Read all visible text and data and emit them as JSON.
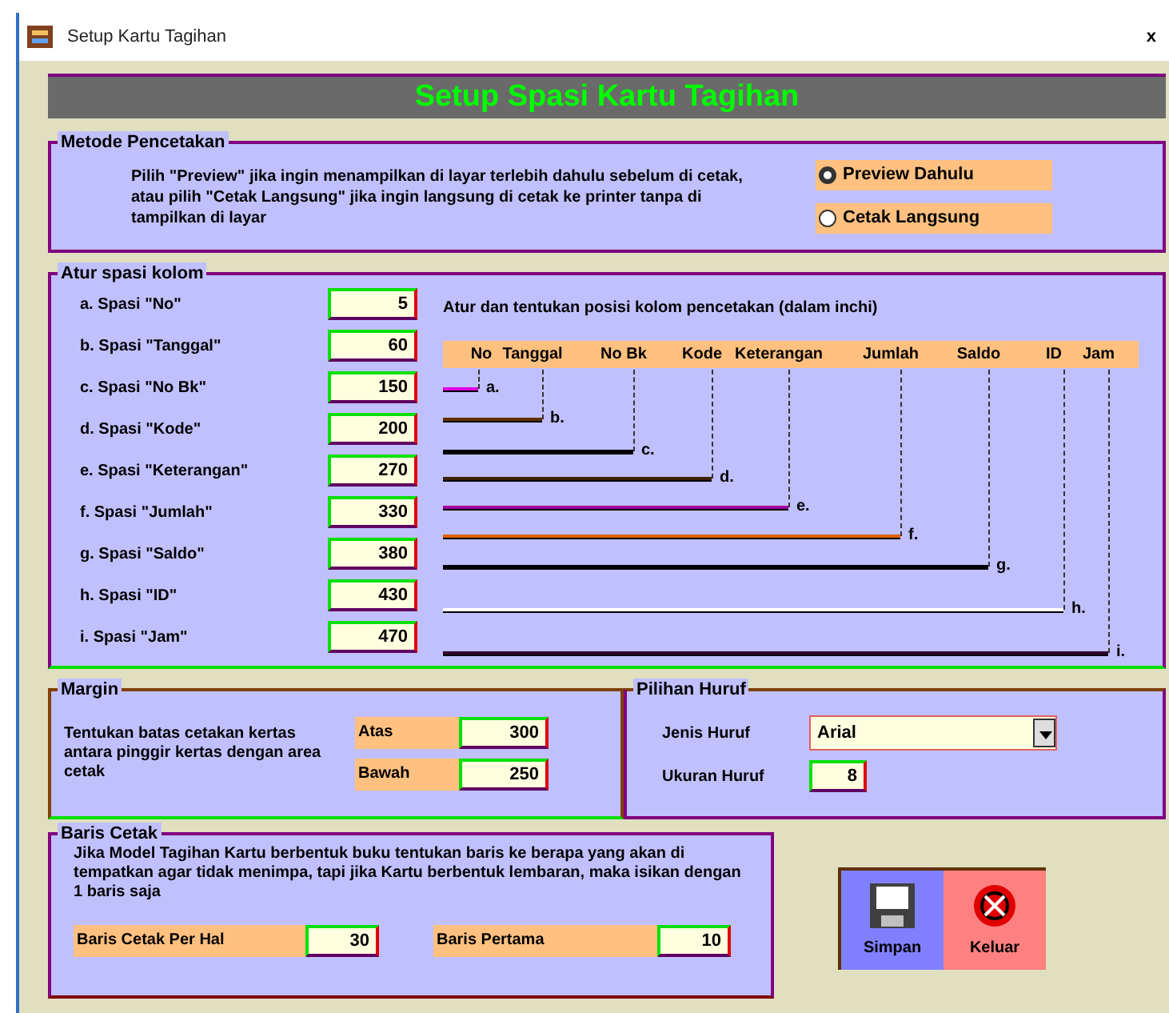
{
  "window": {
    "title": "Setup Kartu Tagihan",
    "close": "x"
  },
  "header": "Setup Spasi Kartu Tagihan",
  "print_method": {
    "title": "Metode Pencetakan",
    "note": "Pilih \"Preview\" jika ingin menampilkan di layar terlebih dahulu sebelum di cetak, atau pilih \"Cetak Langsung\" jika ingin langsung di cetak ke printer tanpa di tampilkan di layar",
    "options": [
      {
        "label": "Preview Dahulu",
        "selected": true
      },
      {
        "label": "Cetak Langsung",
        "selected": false
      }
    ]
  },
  "column_spacing": {
    "title": "Atur spasi kolom",
    "note": "Atur dan tentukan posisi kolom pencetakan (dalam inchi)",
    "columns": [
      "No",
      "Tanggal",
      "No Bk",
      "Kode",
      "Keterangan",
      "Jumlah",
      "Saldo",
      "ID",
      "Jam"
    ],
    "rows": [
      {
        "label": "a. Spasi \"No\"",
        "value": "5",
        "mark": "a."
      },
      {
        "label": "b. Spasi \"Tanggal\"",
        "value": "60",
        "mark": "b."
      },
      {
        "label": "c. Spasi \"No Bk\"",
        "value": "150",
        "mark": "c."
      },
      {
        "label": "d. Spasi \"Kode\"",
        "value": "200",
        "mark": "d."
      },
      {
        "label": "e. Spasi \"Keterangan\"",
        "value": "270",
        "mark": "e."
      },
      {
        "label": "f. Spasi \"Jumlah\"",
        "value": "330",
        "mark": "f."
      },
      {
        "label": "g. Spasi \"Saldo\"",
        "value": "380",
        "mark": "g."
      },
      {
        "label": "h. Spasi \"ID\"",
        "value": "430",
        "mark": "h."
      },
      {
        "label": "i. Spasi \"Jam\"",
        "value": "470",
        "mark": "i."
      }
    ]
  },
  "margin": {
    "title": "Margin",
    "note": "Tentukan batas cetakan kertas antara pinggir kertas dengan area cetak",
    "fields": [
      {
        "label": "Atas",
        "value": "300"
      },
      {
        "label": "Bawah",
        "value": "250"
      }
    ]
  },
  "font": {
    "title": "Pilihan Huruf",
    "type_label": "Jenis Huruf",
    "type_value": "Arial",
    "size_label": "Ukuran Huruf",
    "size_value": "8"
  },
  "print_rows": {
    "title": "Baris Cetak",
    "note": "Jika Model Tagihan Kartu berbentuk buku tentukan baris ke berapa yang akan di tempatkan agar tidak menimpa, tapi jika Kartu berbentuk lembaran, maka isikan dengan 1 baris saja",
    "fields": [
      {
        "label": "Baris Cetak Per Hal",
        "value": "30"
      },
      {
        "label": "Baris Pertama",
        "value": "10"
      }
    ]
  },
  "buttons": [
    {
      "label": "Simpan",
      "kind": "save"
    },
    {
      "label": "Keluar",
      "kind": "exit"
    }
  ]
}
